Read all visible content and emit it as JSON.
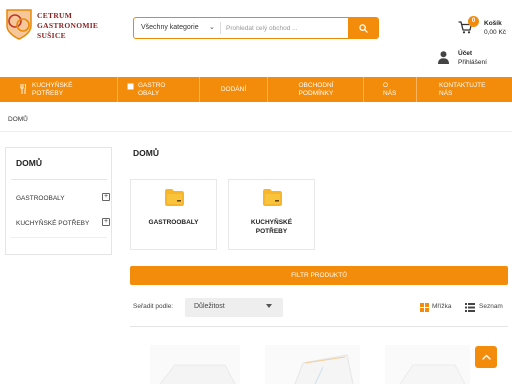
{
  "brand": {
    "logo_lines": [
      "CETRUM",
      "GASTRONOMIE",
      "SUŠICE"
    ],
    "accent": "#f28c0a"
  },
  "search": {
    "category_value": "Všechny kategorie",
    "placeholder": "Prohledat celý obchod ..."
  },
  "cart": {
    "count": "0",
    "label": "Košík",
    "price": "0,00 Kč"
  },
  "account": {
    "label": "Účet",
    "login": "Přihlášení"
  },
  "nav": {
    "items": [
      {
        "label": "KUCHYŇSKÉ POTŘEBY",
        "icon": "utensils-icon"
      },
      {
        "label": "GASTRO OBALY",
        "icon": "box-icon"
      },
      {
        "label": "DODÁNÍ",
        "icon": ""
      },
      {
        "label": "OBCHODNÍ PODMÍNKY",
        "icon": ""
      },
      {
        "label": "O NÁS",
        "icon": ""
      },
      {
        "label": "KONTAKTUJTE NÁS",
        "icon": ""
      }
    ]
  },
  "breadcrumb": "DOMŮ",
  "sidebar": {
    "title": "DOMŮ",
    "items": [
      {
        "label": "GASTROOBALY"
      },
      {
        "label": "KUCHYŇSKÉ POTŘEBY"
      }
    ]
  },
  "main": {
    "title": "DOMŮ",
    "categories": [
      {
        "name": "GASTROOBALY"
      },
      {
        "name": "KUCHYŇSKÉ POTŘEBY"
      }
    ],
    "filter_label": "FILTR PRODUKTŮ",
    "sort_label": "Seřadit podle:",
    "sort_value": "Důležitost",
    "view_grid_label": "Mřížka",
    "view_list_label": "Seznam"
  }
}
